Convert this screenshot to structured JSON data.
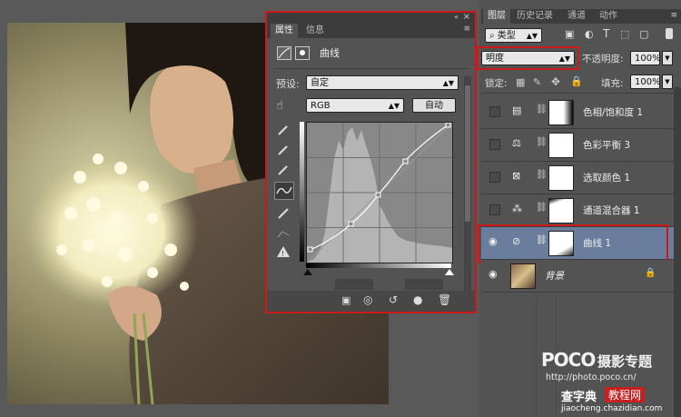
{
  "properties_panel": {
    "tabs": [
      "属性",
      "信息"
    ],
    "header_label": "曲线",
    "preset_label": "预设:",
    "preset_value": "自定",
    "channel_value": "RGB",
    "auto_label": "自动"
  },
  "layers_panel": {
    "tabs": [
      "图层",
      "历史记录",
      "通道",
      "动作"
    ],
    "filter_label": "类型",
    "blend_mode": "明度",
    "opacity_label": "不透明度:",
    "opacity_value": "100%",
    "lock_label": "锁定:",
    "fill_label": "填充:",
    "fill_value": "100%",
    "layers": [
      {
        "name": "色相/饱和度 1",
        "icon": "hue-saturation-icon",
        "visible": false,
        "selected": false
      },
      {
        "name": "色彩平衡 3",
        "icon": "balance-scale-icon",
        "visible": false,
        "selected": false
      },
      {
        "name": "选取颜色 1",
        "icon": "selective-color-icon",
        "visible": false,
        "selected": false
      },
      {
        "name": "通道混合器 1",
        "icon": "channel-mixer-icon",
        "visible": false,
        "selected": false
      },
      {
        "name": "曲线 1",
        "icon": "curves-icon",
        "visible": true,
        "selected": true
      },
      {
        "name": "背景",
        "icon": "background-photo",
        "visible": true,
        "selected": false
      }
    ]
  },
  "watermark": {
    "brand_text": "摄影专题",
    "brand_url": "http://photo.poco.cn/",
    "site_text": "查字典",
    "site_text2": "教程网",
    "site_url": "jiaocheng.chazidian.com"
  },
  "colors": {
    "highlight_border": "#cc1a1a",
    "selected_layer": "#6a7d9c",
    "panel_bg": "#535353"
  }
}
